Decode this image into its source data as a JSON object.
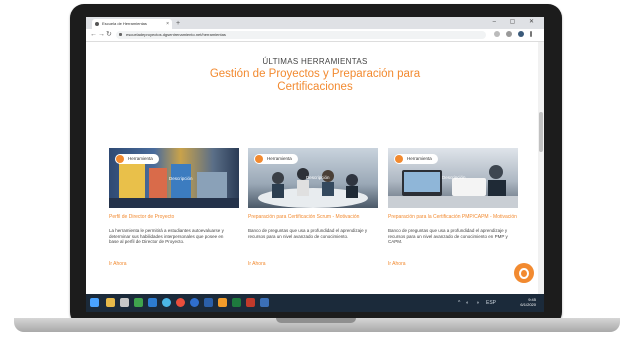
{
  "browser": {
    "tab_title": "Escuela de Herramientas",
    "tab_close": "×",
    "new_tab": "+",
    "window_controls": "–  ▢  ✕",
    "url": "escueladeproyectos.dgsentrenamiento.net/herramientas",
    "nav": {
      "back": "←",
      "forward": "→",
      "reload": "↻"
    }
  },
  "page": {
    "kicker": "ÚLTIMAS HERRAMIENTAS",
    "title_line1": "Gestión de Proyectos y Preparación para",
    "title_line2": "Certificaciones"
  },
  "cards": [
    {
      "badge": "Herramienta",
      "image_overlay": "Descripción",
      "title": "Perfil de Director de Proyecto",
      "description": "La herramienta le permitirá a estudiantes autoevaluarse y determinar sus habilidades interpersonales que posee en base al perfil de Director de Proyecto.",
      "link": "Ir Ahora"
    },
    {
      "badge": "Herramienta",
      "image_overlay": "Descripción",
      "title": "Preparación para Certificación Scrum - Motivación",
      "description": "Banco de preguntas que usa a profundidad el aprendizaje y recursos para un nivel avanzado de conocimiento.",
      "link": "Ir Ahora"
    },
    {
      "badge": "Herramienta",
      "image_overlay": "Descripción",
      "title": "Preparación para la Certificación PMP/CAPM - Motivación",
      "description": "Banco de preguntas que usa a profundidad el aprendizaje y recursos para un nivel avanzado de conocimiento en PMP y CAPM.",
      "link": "Ir Ahora"
    }
  ],
  "taskbar": {
    "time": "9:45",
    "date": "6/1/2020",
    "lang": "ESP"
  },
  "colors": {
    "accent": "#f28a30",
    "taskbar": "#1b2a3a"
  }
}
